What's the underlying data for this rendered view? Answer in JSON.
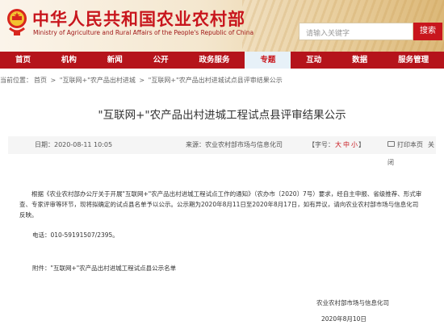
{
  "header": {
    "site_title": "中华人民共和国农业农村部",
    "site_subtitle": "Ministry of Agriculture and Rural Affairs of the People's Republic of China",
    "search_placeholder": "请输入关键字",
    "search_button": "搜索",
    "brand_color": "#c8161d"
  },
  "nav": {
    "items": [
      {
        "label": "首页"
      },
      {
        "label": "机构"
      },
      {
        "label": "新闻"
      },
      {
        "label": "公开"
      },
      {
        "label": "政务服务"
      },
      {
        "label": "专题",
        "active": true
      },
      {
        "label": "互动"
      },
      {
        "label": "数据"
      },
      {
        "label": "服务管理"
      }
    ]
  },
  "breadcrumb": {
    "prefix": "当前位置：",
    "items": [
      "首页",
      "\"互联网+\"农产品出村进城",
      "\"互联网+\"农产品出村进城试点县评审结果公示"
    ],
    "separator": ">"
  },
  "article": {
    "title": "\"互联网+\"农产品出村进城工程试点县评审结果公示",
    "date_label": "日期：",
    "date": "2020-08-11 10:05",
    "source_label": "来源：",
    "source": "农业农村部市场与信息化司",
    "fontsize_label": "【字号：",
    "fontsize_options": [
      "大",
      "中",
      "小"
    ],
    "fontsize_close": "】",
    "print_label": "打印本页",
    "close_label": "关闭",
    "body": "根据《农业农村部办公厅关于开展\"互联网+\"农产品出村进城工程试点工作的通知》（农办市〔2020〕7号）要求，经自主申报、省级推荐、形式审查、专家评审等环节，现将拟确定的试点县名单予以公示。公示期为2020年8月11日至2020年8月17日，如有异议，请向农业农村部市场与信息化司反映。",
    "phone": "电话：010-59191507/2395。",
    "attachment": "附件：\"互联网+\"农产品出村进城工程试点县公示名单",
    "sign_org": "农业农村部市场与信息化司",
    "sign_date": "2020年8月10日"
  }
}
